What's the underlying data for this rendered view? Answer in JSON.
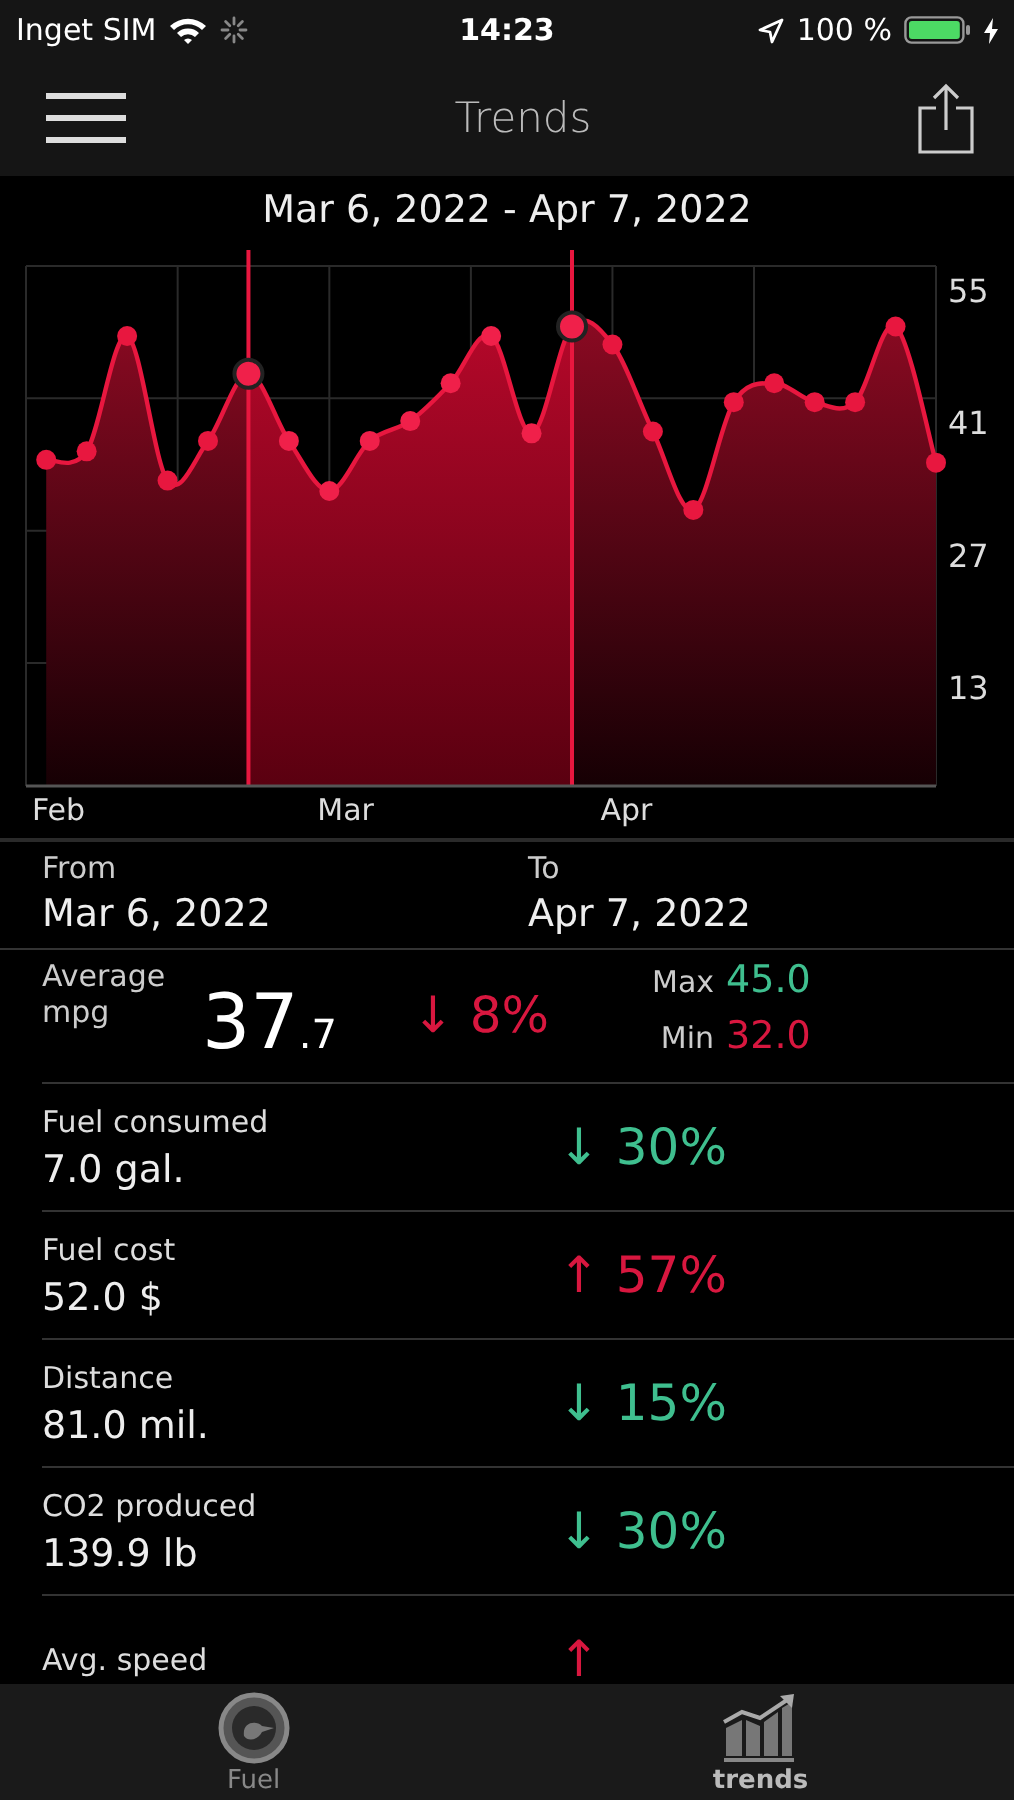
{
  "status_bar": {
    "carrier": "Inget SIM",
    "time": "14:23",
    "battery": "100 %"
  },
  "nav": {
    "title": "Trends"
  },
  "range_title": "Mar 6, 2022 - Apr 7, 2022",
  "chart": {
    "chart_data": {
      "type": "area",
      "categories": [
        "Feb",
        null,
        null,
        null,
        null,
        null,
        null,
        "Mar",
        null,
        null,
        null,
        null,
        null,
        null,
        "Apr",
        null,
        null,
        null,
        null,
        null,
        null,
        null,
        null
      ],
      "series": [
        {
          "color": "#e8173f",
          "values": [
            34.5,
            35.4,
            47.6,
            32.3,
            36.5,
            43.6,
            36.5,
            31.2,
            36.5,
            38.6,
            42.6,
            47.6,
            37.3,
            48.6,
            46.7,
            37.5,
            29.2,
            40.6,
            42.6,
            40.6,
            40.6,
            48.6,
            34.2
          ]
        }
      ],
      "ylim": [
        0,
        55
      ],
      "grid": true,
      "yticks": [
        13,
        27,
        41,
        55
      ]
    },
    "in_selection": [
      false,
      false,
      false,
      false,
      false,
      true,
      true,
      true,
      true,
      true,
      true,
      true,
      true,
      true,
      false,
      false,
      false,
      false,
      false,
      false,
      false,
      false,
      false
    ]
  },
  "period": {
    "from_label": "From",
    "from": "Mar 6, 2022",
    "to_label": "To",
    "to": "Apr 7, 2022"
  },
  "average": {
    "label": "Average",
    "unit": "mpg",
    "value": "37$_{.7}$",
    "good": false,
    "change": "↓ 8%",
    "max_label": "Max",
    "max": "45.0",
    "min_label": "Min",
    "min": "32.0"
  },
  "metrics": [
    {
      "label": "Fuel consumed",
      "value": "7.0 gal.",
      "good": true,
      "change": "↓ 30%"
    },
    {
      "label": "Fuel cost",
      "value": "52.0 $",
      "good": false,
      "change": "↑ 57%"
    },
    {
      "label": "Distance",
      "value": "81.0 mil.",
      "good": true,
      "change": "↓ 15%"
    },
    {
      "label": "CO2 produced",
      "value": "139.9 lb",
      "good": true,
      "change": "↓ 30%"
    },
    {
      "label": "Avg. speed",
      "good": false,
      "change": "↑"
    }
  ],
  "tabs": [
    {
      "label": "Fuel",
      "kind": "gauge",
      "selected": false
    },
    {
      "label": "trends",
      "kind": "chart",
      "selected": true
    }
  ]
}
